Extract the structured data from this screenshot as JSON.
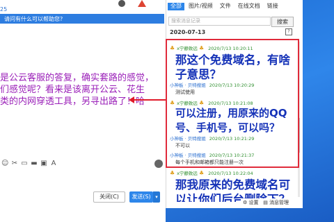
{
  "window": {
    "top_number": "25",
    "greeting_placeholder": "请问有什么可以帮助您?"
  },
  "left_chat": {
    "lines": [
      "是公云客服的答复，确实套路的感觉，",
      "们感觉呢？看来是该离开公云、花生",
      "类的内网穿透工具，另寻出路了！哈"
    ]
  },
  "toolbar": {
    "icons": [
      "emoji-icon",
      "scissors-icon",
      "image-icon",
      "folder-icon",
      "window-icon",
      "font-icon"
    ]
  },
  "footer_buttons": {
    "close_label": "关闭(C)",
    "send_label": "发送(S)",
    "send_dropdown": "▾"
  },
  "history_panel": {
    "tabs": [
      "全部",
      "图片/视频",
      "文件",
      "在线文档",
      "链接"
    ],
    "active_tab": "全部",
    "search_placeholder": "搜索消息记录",
    "search_button": "搜索",
    "date": "2020-07-13",
    "messages": [
      {
        "sender": "x宁静致远",
        "time": "2020/7/13 10:20:11",
        "text": [
          "那这个免费域名，有啥",
          "子意思？"
        ],
        "style": "big"
      },
      {
        "sender": "小神板 · 贝特搜姐",
        "time": "2020/7/13 10:20:29",
        "text": [
          "测试使用"
        ],
        "style": "small"
      },
      {
        "sender": "x宁静致远",
        "time": "2020/7/13 10:21:08",
        "text": [
          "可以注册，用原来的QQ",
          "号、手机号，可以吗？"
        ],
        "style": "big"
      },
      {
        "sender": "小神板 · 贝特搜姐",
        "time": "2020/7/13 10:21:29",
        "text": [
          "不可以"
        ],
        "style": "small"
      },
      {
        "sender": "小神板 · 贝特搜姐",
        "time": "2020/7/13 10:21:37",
        "text": [
          "每个手机和邮箱都只能注册一次"
        ],
        "style": "small"
      },
      {
        "sender": "x宁静致远",
        "time": "2020/7/13 10:22:04",
        "text": [
          "那我原来的免费域名可",
          "以让你们后台删除下？"
        ],
        "style": "big"
      }
    ],
    "bottom_tools": [
      "设置",
      "消息管理"
    ]
  },
  "colors": {
    "accent": "#2d86ea",
    "highlight_border": "#e02a3a",
    "annotation_text": "#9a1fb8",
    "question_text": "#1633b8"
  }
}
